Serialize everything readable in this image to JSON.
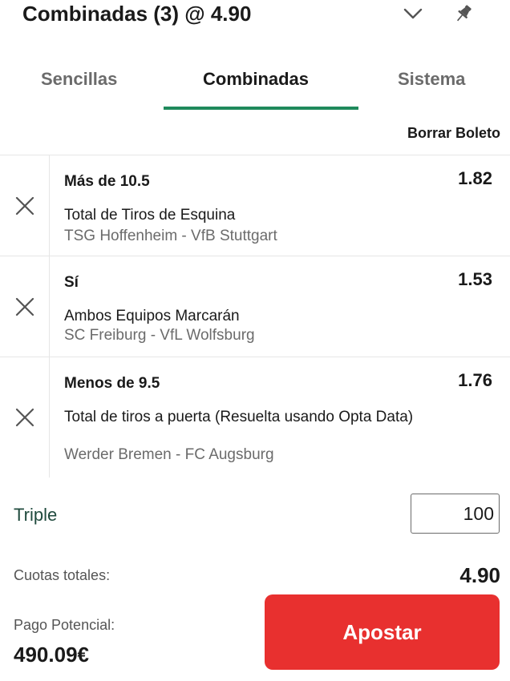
{
  "header": {
    "title": "Combinadas (3) @ 4.90"
  },
  "tabs": [
    {
      "label": "Sencillas"
    },
    {
      "label": "Combinadas"
    },
    {
      "label": "Sistema"
    }
  ],
  "clear_label": "Borrar Boleto",
  "selections": [
    {
      "pick": "Más de 10.5",
      "odds": "1.82",
      "market": "Total de Tiros de Esquina",
      "event": "TSG Hoffenheim - VfB Stuttgart"
    },
    {
      "pick": "Sí",
      "odds": "1.53",
      "market": "Ambos Equipos Marcarán",
      "event": "SC Freiburg - VfL Wolfsburg"
    },
    {
      "pick": "Menos de 9.5",
      "odds": "1.76",
      "market": "Total de tiros a puerta (Resuelta usando Opta Data)",
      "event": "Werder Bremen - FC Augsburg"
    }
  ],
  "stake": {
    "label": "Triple",
    "value": "100"
  },
  "summary": {
    "total_odds_label": "Cuotas totales:",
    "total_odds": "4.90",
    "payout_label": "Pago Potencial:",
    "payout": "490.09€"
  },
  "bet_button_label": "Apostar",
  "icons": {
    "chevron": "chevron-down-icon",
    "pin": "pin-icon",
    "remove": "close-icon"
  },
  "colors": {
    "accent": "#1f8a5c",
    "bet_button": "#e8302f"
  }
}
